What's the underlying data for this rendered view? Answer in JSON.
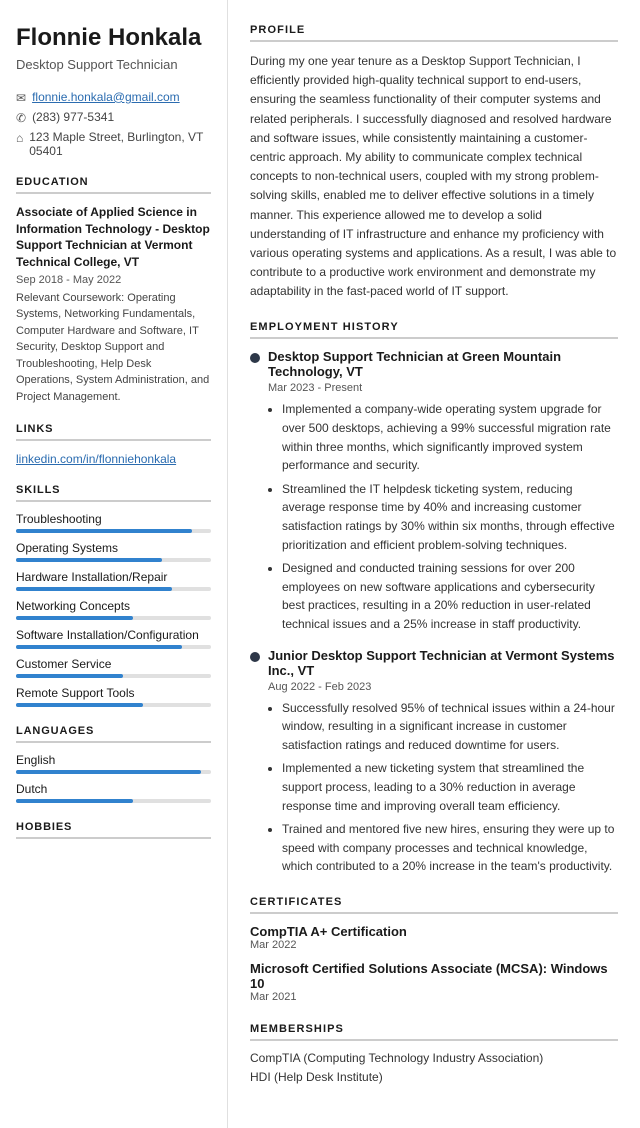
{
  "sidebar": {
    "name": "Flonnie Honkala",
    "job_title": "Desktop Support Technician",
    "contact": {
      "email": "flonnie.honkala@gmail.com",
      "phone": "(283) 977-5341",
      "address": "123 Maple Street, Burlington, VT 05401"
    },
    "education_title": "EDUCATION",
    "education": {
      "degree": "Associate of Applied Science in Information Technology - Desktop Support Technician at Vermont Technical College, VT",
      "date": "Sep 2018 - May 2022",
      "coursework_label": "Relevant Coursework:",
      "coursework": "Operating Systems, Networking Fundamentals, Computer Hardware and Software, IT Security, Desktop Support and Troubleshooting, Help Desk Operations, System Administration, and Project Management."
    },
    "links_title": "LINKS",
    "links": [
      {
        "label": "linkedin.com/in/flonniehonkala",
        "url": "#"
      }
    ],
    "skills_title": "SKILLS",
    "skills": [
      {
        "label": "Troubleshooting",
        "pct": 90
      },
      {
        "label": "Operating Systems",
        "pct": 75
      },
      {
        "label": "Hardware Installation/Repair",
        "pct": 80
      },
      {
        "label": "Networking Concepts",
        "pct": 60
      },
      {
        "label": "Software Installation/Configuration",
        "pct": 85
      },
      {
        "label": "Customer Service",
        "pct": 55
      },
      {
        "label": "Remote Support Tools",
        "pct": 65
      }
    ],
    "languages_title": "LANGUAGES",
    "languages": [
      {
        "label": "English",
        "pct": 95
      },
      {
        "label": "Dutch",
        "pct": 60
      }
    ],
    "hobbies_title": "HOBBIES"
  },
  "main": {
    "profile_title": "PROFILE",
    "profile_text": "During my one year tenure as a Desktop Support Technician, I efficiently provided high-quality technical support to end-users, ensuring the seamless functionality of their computer systems and related peripherals. I successfully diagnosed and resolved hardware and software issues, while consistently maintaining a customer-centric approach. My ability to communicate complex technical concepts to non-technical users, coupled with my strong problem-solving skills, enabled me to deliver effective solutions in a timely manner. This experience allowed me to develop a solid understanding of IT infrastructure and enhance my proficiency with various operating systems and applications. As a result, I was able to contribute to a productive work environment and demonstrate my adaptability in the fast-paced world of IT support.",
    "employment_title": "EMPLOYMENT HISTORY",
    "jobs": [
      {
        "title": "Desktop Support Technician at Green Mountain Technology, VT",
        "date": "Mar 2023 - Present",
        "bullets": [
          "Implemented a company-wide operating system upgrade for over 500 desktops, achieving a 99% successful migration rate within three months, which significantly improved system performance and security.",
          "Streamlined the IT helpdesk ticketing system, reducing average response time by 40% and increasing customer satisfaction ratings by 30% within six months, through effective prioritization and efficient problem-solving techniques.",
          "Designed and conducted training sessions for over 200 employees on new software applications and cybersecurity best practices, resulting in a 20% reduction in user-related technical issues and a 25% increase in staff productivity."
        ]
      },
      {
        "title": "Junior Desktop Support Technician at Vermont Systems Inc., VT",
        "date": "Aug 2022 - Feb 2023",
        "bullets": [
          "Successfully resolved 95% of technical issues within a 24-hour window, resulting in a significant increase in customer satisfaction ratings and reduced downtime for users.",
          "Implemented a new ticketing system that streamlined the support process, leading to a 30% reduction in average response time and improving overall team efficiency.",
          "Trained and mentored five new hires, ensuring they were up to speed with company processes and technical knowledge, which contributed to a 20% increase in the team's productivity."
        ]
      }
    ],
    "certificates_title": "CERTIFICATES",
    "certificates": [
      {
        "name": "CompTIA A+ Certification",
        "date": "Mar 2022"
      },
      {
        "name": "Microsoft Certified Solutions Associate (MCSA): Windows 10",
        "date": "Mar 2021"
      }
    ],
    "memberships_title": "MEMBERSHIPS",
    "memberships": [
      "CompTIA (Computing Technology Industry Association)",
      "HDI (Help Desk Institute)"
    ]
  }
}
